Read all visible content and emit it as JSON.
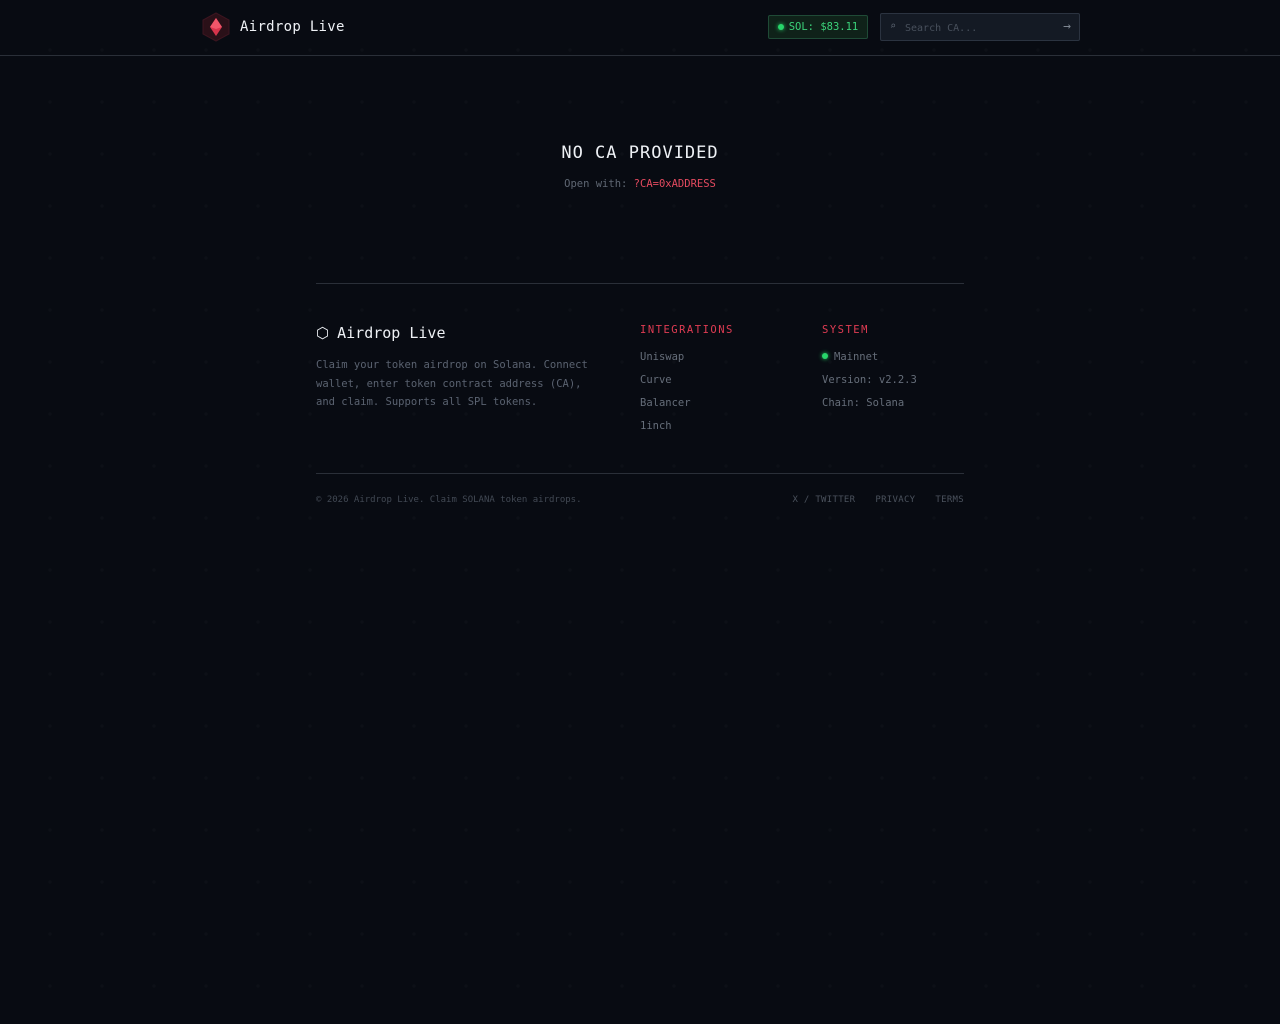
{
  "header": {
    "brand_name": "Airdrop Live",
    "sol_price": "SOL: $83.11",
    "search_placeholder": "Search CA...",
    "search_icon": "⌕",
    "go_arrow": "→"
  },
  "main": {
    "title": "NO CA PROVIDED",
    "hint_prefix": "Open with:",
    "hint_code": "?CA=0xADDRESS"
  },
  "footer": {
    "hex_glyph": "⬡",
    "brand_name": "Airdrop Live",
    "description": "Claim your token airdrop on Solana. Connect wallet, enter token contract address (CA), and claim. Supports all SPL tokens.",
    "integrations": {
      "heading": "INTEGRATIONS",
      "items": [
        "Uniswap",
        "Curve",
        "Balancer",
        "1inch"
      ]
    },
    "system": {
      "heading": "SYSTEM",
      "network": "Mainnet",
      "version": "Version: v2.2.3",
      "chain": "Chain: Solana"
    },
    "copyright": "© 2026 Airdrop Live. Claim SOLANA token airdrops.",
    "links": [
      "X / TWITTER",
      "PRIVACY",
      "TERMS"
    ]
  },
  "colors": {
    "background": "#080b12",
    "accent_red": "#e03c53",
    "accent_green": "#27d66a",
    "border": "#2a2f38"
  },
  "icons": {
    "logo": "red-gem-hexagon-icon",
    "search": "search-icon",
    "arrow": "arrow-right-icon",
    "status": "green-dot-icon"
  }
}
